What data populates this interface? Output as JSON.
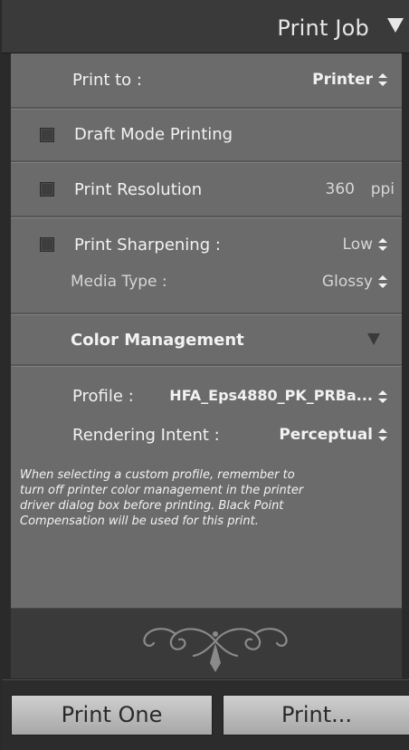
{
  "header": {
    "title": "Print Job"
  },
  "print_to": {
    "label": "Print to :",
    "value": "Printer"
  },
  "draft_mode": {
    "label": "Draft Mode Printing",
    "checked": false
  },
  "resolution": {
    "label": "Print Resolution",
    "value": "360",
    "unit": "ppi",
    "checked": false
  },
  "sharpening": {
    "label": "Print Sharpening :",
    "value": "Low",
    "checked": false,
    "media_label": "Media Type :",
    "media_value": "Glossy"
  },
  "color_management": {
    "title": "Color Management",
    "profile_label": "Profile :",
    "profile_value": "HFA_Eps4880_PK_PRBa...",
    "intent_label": "Rendering Intent :",
    "intent_value": "Perceptual",
    "note_line1": "When selecting a custom profile, remember to",
    "note_line2": "turn off printer color management in the printer",
    "note_line3": "driver dialog box before printing. Black Point",
    "note_line4": "Compensation will be used for this print."
  },
  "buttons": {
    "print_one": "Print One",
    "print": "Print..."
  },
  "colors": {
    "panel": "#6b6b6b",
    "header": "#3a3a3a",
    "background": "#2a2a2a",
    "button": "#bdbdbd"
  }
}
